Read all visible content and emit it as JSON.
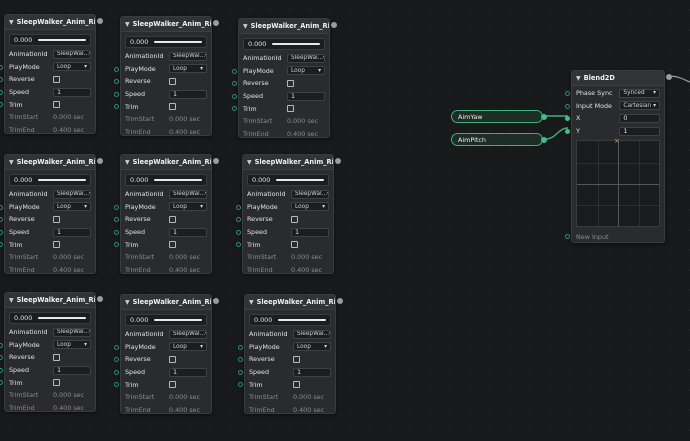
{
  "clip_nodes": [
    {
      "title": "SleepWalker_Anim_Rifle_Ai...",
      "time": "0.000",
      "anim_id": "SleepWal...",
      "play_mode": "Loop",
      "speed": "1",
      "trim_start": "0.000 sec",
      "trim_end": "0.400 sec"
    },
    {
      "title": "SleepWalker_Anim_Rifle_Ai...",
      "time": "0.000",
      "anim_id": "SleepWal...",
      "play_mode": "Loop",
      "speed": "1",
      "trim_start": "0.000 sec",
      "trim_end": "0.400 sec"
    },
    {
      "title": "SleepWalker_Anim_Rifle_Ai...",
      "time": "0.000",
      "anim_id": "SleepWal...",
      "play_mode": "Loop",
      "speed": "1",
      "trim_start": "0.000 sec",
      "trim_end": "0.400 sec"
    },
    {
      "title": "SleepWalker_Anim_Rifle_Ai...",
      "time": "0.000",
      "anim_id": "SleepWal...",
      "play_mode": "Loop",
      "speed": "1",
      "trim_start": "0.000 sec",
      "trim_end": "0.400 sec"
    },
    {
      "title": "SleepWalker_Anim_Rifle_Ai...",
      "time": "0.000",
      "anim_id": "SleepWal...",
      "play_mode": "Loop",
      "speed": "1",
      "trim_start": "0.000 sec",
      "trim_end": "0.400 sec"
    },
    {
      "title": "SleepWalker_Anim_Rifle_Ai...",
      "time": "0.000",
      "anim_id": "SleepWal...",
      "play_mode": "Loop",
      "speed": "1",
      "trim_start": "0.000 sec",
      "trim_end": "0.400 sec"
    },
    {
      "title": "SleepWalker_Anim_Rifle_Ai...",
      "time": "0.000",
      "anim_id": "SleepWal...",
      "play_mode": "Loop",
      "speed": "1",
      "trim_start": "0.000 sec",
      "trim_end": "0.400 sec"
    },
    {
      "title": "SleepWalker_Anim_Rifle_Ai...",
      "time": "0.000",
      "anim_id": "SleepWal...",
      "play_mode": "Loop",
      "speed": "1",
      "trim_start": "0.000 sec",
      "trim_end": "0.400 sec"
    },
    {
      "title": "SleepWalker_Anim_Rifle_Ai...",
      "time": "0.000",
      "anim_id": "SleepWal...",
      "play_mode": "Loop",
      "speed": "1",
      "trim_start": "0.000 sec",
      "trim_end": "0.400 sec"
    }
  ],
  "labels": {
    "animation_id": "AnimationId",
    "play_mode": "PlayMode",
    "reverse": "Reverse",
    "speed": "Speed",
    "trim": "Trim",
    "trim_start": "TrimStart",
    "trim_end": "TrimEnd"
  },
  "params": {
    "aim_yaw": "AimYaw",
    "aim_pitch": "AimPitch"
  },
  "blend": {
    "title": "Blend2D",
    "phase_sync_label": "Phase Sync",
    "phase_sync_value": "Synced",
    "input_mode_label": "Input Mode",
    "input_mode_value": "Cartesian",
    "x_label": "X",
    "x_value": "0",
    "y_label": "Y",
    "y_value": "1",
    "new_input": "New Input",
    "marker": "×"
  },
  "colors": {
    "accent": "#3fae7c",
    "canvas": "#18191b",
    "node": "#2a2b2e"
  }
}
